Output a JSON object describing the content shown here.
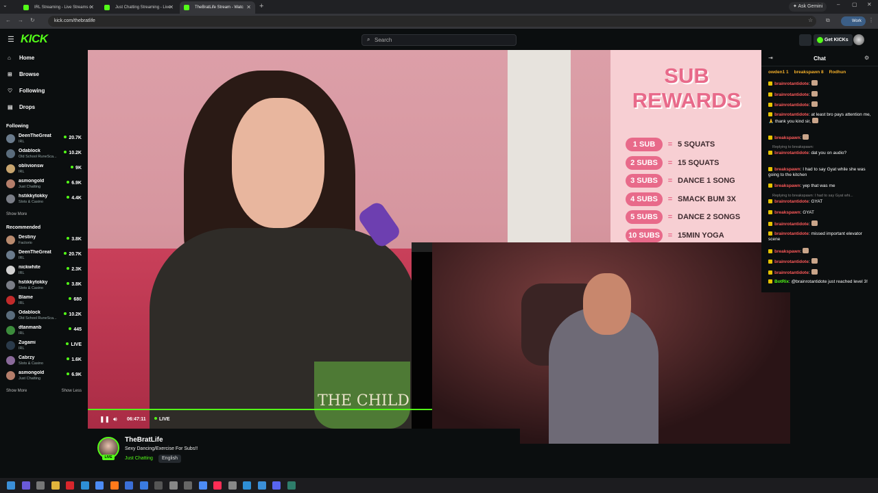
{
  "browser": {
    "tabs": [
      {
        "title": "IRL Streaming - Live Streams o",
        "fav": "#53fc18"
      },
      {
        "title": "Just Chatting Streaming - Live",
        "fav": "#53fc18"
      },
      {
        "title": "TheBratLife Stream - Watc",
        "fav": "#53fc18"
      }
    ],
    "new_tab": "+",
    "ask_gemini": "Ask Gemini",
    "url": "kick.com/thebratlife",
    "profile": "Work"
  },
  "kick": {
    "logo": "KICK",
    "search_placeholder": "Search",
    "get_kicks": "Get KICKs"
  },
  "nav": [
    {
      "label": "Home",
      "icon": "home-icon",
      "glyph": "⌂"
    },
    {
      "label": "Browse",
      "icon": "browse-icon",
      "glyph": "⊞"
    },
    {
      "label": "Following",
      "icon": "heart-icon",
      "glyph": "♡"
    },
    {
      "label": "Drops",
      "icon": "drops-icon",
      "glyph": "▤"
    }
  ],
  "following": {
    "title": "Following",
    "channels": [
      {
        "name": "DeenTheGreat",
        "category": "IRL",
        "viewers": "20.7K",
        "color": "#6a7b8c"
      },
      {
        "name": "Odablock",
        "category": "Old School RuneSca...",
        "viewers": "10.2K",
        "color": "#5a6c7c"
      },
      {
        "name": "oblivionsw",
        "category": "IRL",
        "viewers": "9K",
        "color": "#c7a46e"
      },
      {
        "name": "asmongold",
        "category": "Just Chatting",
        "viewers": "6.9K",
        "color": "#b47d6a"
      },
      {
        "name": "hstikkytokky",
        "category": "Slots & Casino",
        "viewers": "4.4K",
        "color": "#7a7d86"
      }
    ],
    "show_more": "Show More"
  },
  "recommended": {
    "title": "Recommended",
    "channels": [
      {
        "name": "Destiny",
        "category": "Factorio",
        "viewers": "3.8K",
        "color": "#b88a6e"
      },
      {
        "name": "DeenTheGreat",
        "category": "IRL",
        "viewers": "20.7K",
        "color": "#6a7b8c"
      },
      {
        "name": "nickwhite",
        "category": "IRL",
        "viewers": "2.3K",
        "color": "#d2d2d2"
      },
      {
        "name": "hstikkytokky",
        "category": "Slots & Casino",
        "viewers": "3.8K",
        "color": "#7a7d86"
      },
      {
        "name": "Blame",
        "category": "IRL",
        "viewers": "680",
        "color": "#c22a2a"
      },
      {
        "name": "Odablock",
        "category": "Old School RuneSca...",
        "viewers": "10.2K",
        "color": "#5a6c7c"
      },
      {
        "name": "dtanmanb",
        "category": "IRL",
        "viewers": "445",
        "color": "#3c8c3c"
      },
      {
        "name": "Zugami",
        "category": "IRL",
        "viewers": "LIVE",
        "color": "#2a3a4a"
      },
      {
        "name": "Cabrzy",
        "category": "Slots & Casino",
        "viewers": "1.6K",
        "color": "#8a6a9a"
      },
      {
        "name": "asmongold",
        "category": "Just Chatting",
        "viewers": "6.9K",
        "color": "#b47d6a"
      }
    ],
    "show_more": "Show More",
    "show_less": "Show Less"
  },
  "board": {
    "title": "SUB REWARDS",
    "rows": [
      {
        "tier": "1 SUB",
        "reward": "5 SQUATS"
      },
      {
        "tier": "2 SUBS",
        "reward": "15 SQUATS"
      },
      {
        "tier": "3 SUBS",
        "reward": "DANCE 1 SONG"
      },
      {
        "tier": "4 SUBS",
        "reward": "SMACK BUM 3X"
      },
      {
        "tier": "5 SUBS",
        "reward": "DANCE 2 SONGS"
      },
      {
        "tier": "10 SUBS",
        "reward": "15MIN YOGA"
      }
    ],
    "mug_text": "THE CHILD"
  },
  "player": {
    "time": "06:47:11",
    "live": "LIVE",
    "progress": 1.0
  },
  "stream": {
    "name": "TheBratLife",
    "title": "Sexy Dancing/Exercise For Subs!!",
    "category": "Just Chatting",
    "language": "English",
    "live_badge": "LIVE"
  },
  "chat": {
    "title": "Chat",
    "gifters": [
      "owden1 1",
      "breakspawn 8",
      "Rodhun"
    ],
    "messages": [
      {
        "user": "brainrotantidote",
        "color": "#ff5a5a",
        "text": ":",
        "emote": true
      },
      {
        "user": "brainrotantidote",
        "color": "#ff5a5a",
        "text": ":",
        "emote": true
      },
      {
        "user": "brainrotantidote",
        "color": "#ff5a5a",
        "text": ":",
        "emote": true
      },
      {
        "user": "brainrotantidote",
        "color": "#ff5a5a",
        "text": ": at least bro pays attention me, 🙏 thank you kind sir,",
        "emote": true
      },
      {
        "user": "breakspawn",
        "color": "#ff5a5a",
        "text": ":",
        "emote": true
      },
      {
        "reply": "Replying to breakspawn:"
      },
      {
        "user": "brainrotantidote",
        "color": "#ff5a5a",
        "text": ": dat you on audio?",
        "emote": false
      },
      {
        "user": "breakspawn",
        "color": "#ff5a5a",
        "text": ": I had to say Gyat while she was going to the kitchen",
        "emote": false
      },
      {
        "user": "breakspawn",
        "color": "#ff5a5a",
        "text": ": yep that was me",
        "emote": false
      },
      {
        "reply": "Replying to breakspawn: I had to say Gyat whi..."
      },
      {
        "user": "brainrotantidote",
        "color": "#ff5a5a",
        "text": ": GYAT",
        "emote": false
      },
      {
        "user": "breakspawn",
        "color": "#ff5a5a",
        "text": ": GYAT",
        "emote": false
      },
      {
        "user": "brainrotantidote",
        "color": "#ff5a5a",
        "text": ":",
        "emote": true
      },
      {
        "user": "brainrotantidote",
        "color": "#ff5a5a",
        "text": ": missed important elevator scene",
        "emote": false
      },
      {
        "user": "breakspawn",
        "color": "#ff5a5a",
        "text": ":",
        "emote": true
      },
      {
        "user": "brainrotantidote",
        "color": "#ff5a5a",
        "text": ":",
        "emote": true
      },
      {
        "user": "brainrotantidote",
        "color": "#ff5a5a",
        "text": ":",
        "emote": true
      },
      {
        "user": "BotRix",
        "color": "#53fc18",
        "text": ": @brainrotantidote just reached level 3!",
        "emote": false
      }
    ]
  },
  "taskbar": {
    "icons": [
      "windows-icon",
      "copilot-icon",
      "task-view-icon",
      "explorer-icon",
      "opera-icon",
      "edge-icon",
      "chrome-icon",
      "firefox-icon",
      "store-icon",
      "mail-icon",
      "calculator-icon",
      "settings-icon",
      "app-icon",
      "chrome2-icon",
      "tiktok-icon",
      "gamepad-icon",
      "app2-icon",
      "photos-icon",
      "discord-icon",
      "terminal-icon"
    ]
  }
}
